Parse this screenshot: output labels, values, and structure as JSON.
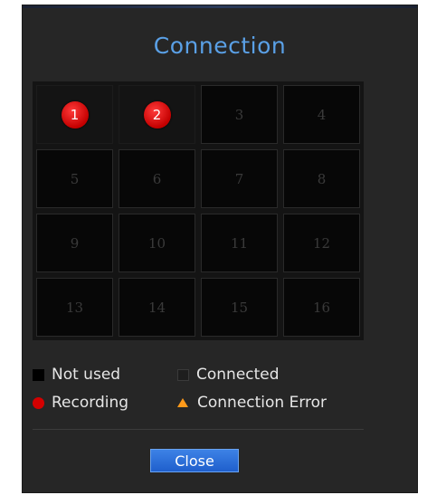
{
  "dialog": {
    "title": "Connection",
    "close_label": "Close"
  },
  "channels": [
    {
      "label": "1",
      "status": "recording"
    },
    {
      "label": "2",
      "status": "recording"
    },
    {
      "label": "3",
      "status": "not-used"
    },
    {
      "label": "4",
      "status": "not-used"
    },
    {
      "label": "5",
      "status": "not-used"
    },
    {
      "label": "6",
      "status": "not-used"
    },
    {
      "label": "7",
      "status": "not-used"
    },
    {
      "label": "8",
      "status": "not-used"
    },
    {
      "label": "9",
      "status": "not-used"
    },
    {
      "label": "10",
      "status": "not-used"
    },
    {
      "label": "11",
      "status": "not-used"
    },
    {
      "label": "12",
      "status": "not-used"
    },
    {
      "label": "13",
      "status": "not-used"
    },
    {
      "label": "14",
      "status": "not-used"
    },
    {
      "label": "15",
      "status": "not-used"
    },
    {
      "label": "16",
      "status": "not-used"
    }
  ],
  "legend": {
    "not_used": "Not used",
    "connected": "Connected",
    "recording": "Recording",
    "connection_error": "Connection Error"
  },
  "colors": {
    "title": "#5aa0e6",
    "recording": "#d40000",
    "error": "#ff9a1a",
    "button": "#2a6fd9"
  }
}
